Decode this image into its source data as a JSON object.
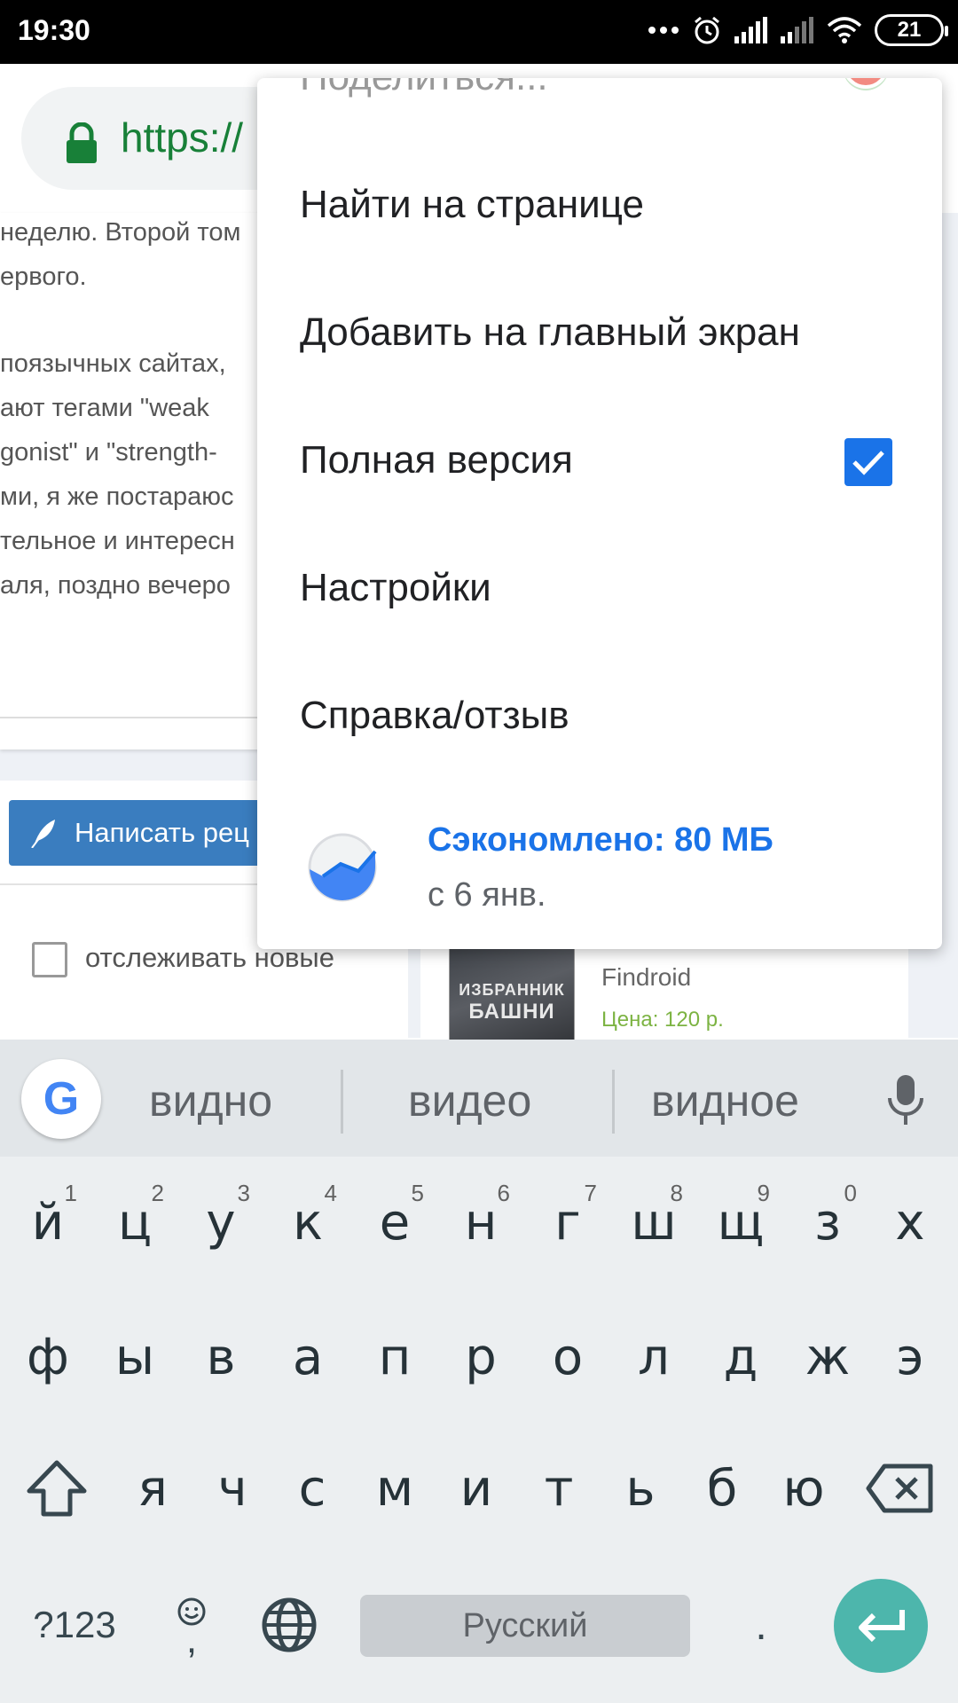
{
  "status_bar": {
    "time": "19:30",
    "battery": "21",
    "icons": [
      "more-dots-icon",
      "alarm-icon",
      "signal-icon",
      "signal-icon",
      "wifi-icon",
      "battery-icon"
    ]
  },
  "browser": {
    "url_visible": "https://"
  },
  "page": {
    "article_lines": [
      "неделю. Второй том",
      "ервого.",
      "",
      "поязычных сайтах,",
      "ают тегами \"weak",
      "gonist\" и \"strength-",
      "ми, я же постараюс",
      "тельное и интересн",
      "аля, поздно вечеро"
    ],
    "review_button_label": "Написать рец",
    "track_label": "отслеживать новые",
    "book": {
      "cover_line1": "ИЗБРАННИК",
      "cover_line2": "БАШНИ",
      "author": "Findroid",
      "price": "Цена: 120 р."
    }
  },
  "menu": {
    "partial_item": "Поделиться...",
    "items": [
      {
        "label": "Найти на странице"
      },
      {
        "label": "Добавить на главный экран"
      },
      {
        "label": "Полная версия",
        "checked": true
      },
      {
        "label": "Настройки"
      },
      {
        "label": "Справка/отзыв"
      }
    ],
    "savings_title": "Сэкономлено: 80 МБ",
    "savings_subtitle": "с 6 янв."
  },
  "keyboard": {
    "suggestions": [
      "видно",
      "видео",
      "видное"
    ],
    "google_label": "G",
    "row1": [
      {
        "key": "й",
        "hint": "1"
      },
      {
        "key": "ц",
        "hint": "2"
      },
      {
        "key": "у",
        "hint": "3"
      },
      {
        "key": "к",
        "hint": "4"
      },
      {
        "key": "е",
        "hint": "5"
      },
      {
        "key": "н",
        "hint": "6"
      },
      {
        "key": "г",
        "hint": "7"
      },
      {
        "key": "ш",
        "hint": "8"
      },
      {
        "key": "щ",
        "hint": "9"
      },
      {
        "key": "з",
        "hint": "0"
      },
      {
        "key": "х",
        "hint": ""
      }
    ],
    "row2": [
      "ф",
      "ы",
      "в",
      "а",
      "п",
      "р",
      "о",
      "л",
      "д",
      "ж",
      "э"
    ],
    "row3": [
      "я",
      "ч",
      "с",
      "м",
      "и",
      "т",
      "ь",
      "б",
      "ю"
    ],
    "symbols_label": "?123",
    "comma_label": ",",
    "space_label": "Русский",
    "period_label": ".",
    "accent_color": "#4db6ac"
  }
}
